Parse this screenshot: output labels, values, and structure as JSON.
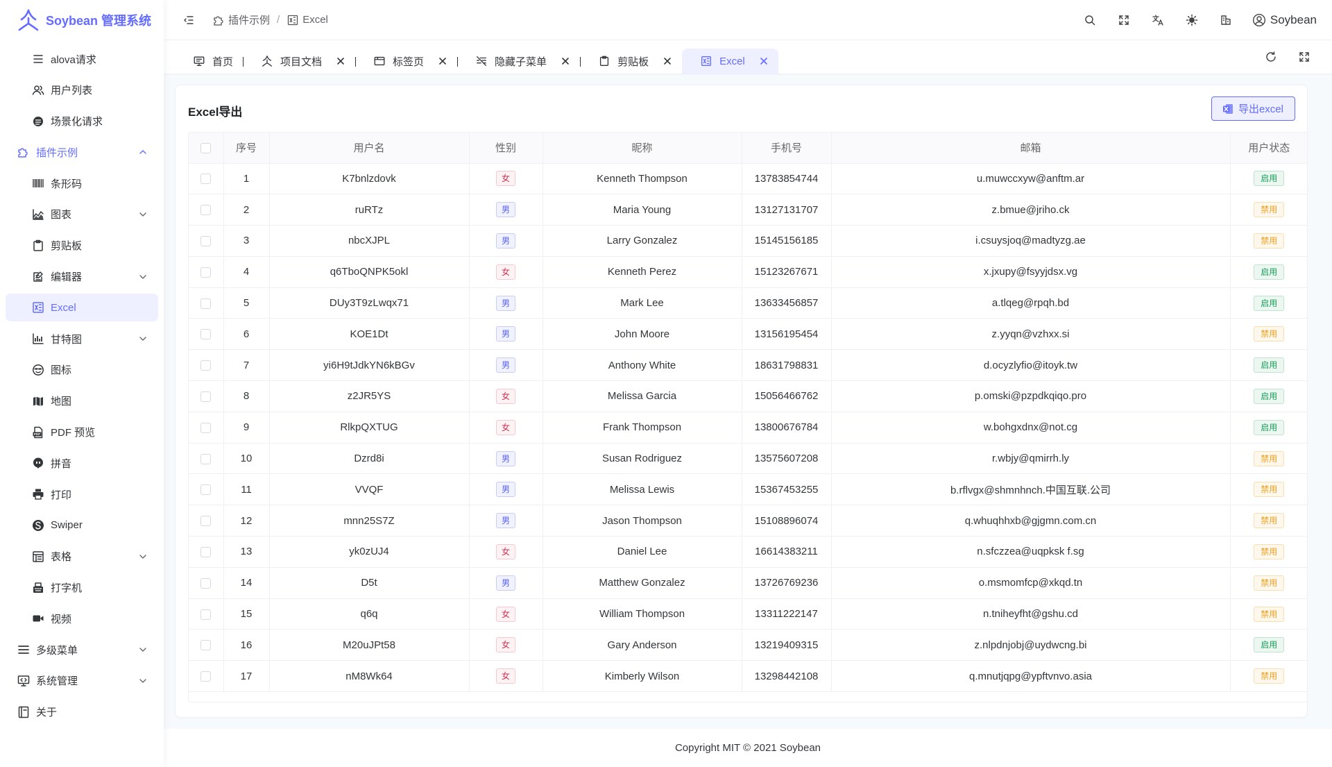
{
  "app": {
    "title": "Soybean 管理系统"
  },
  "sidebar": {
    "items": [
      {
        "label": "alova请求",
        "icon": "list-icon",
        "level": 1
      },
      {
        "label": "用户列表",
        "icon": "users-icon",
        "level": 1
      },
      {
        "label": "场景化请求",
        "icon": "stack-icon",
        "level": 1
      },
      {
        "label": "插件示例",
        "icon": "plugin-icon",
        "level": 0,
        "arrow": "up",
        "open": true
      },
      {
        "label": "条形码",
        "icon": "barcode-icon",
        "level": 1
      },
      {
        "label": "图表",
        "icon": "chart-icon",
        "level": 1,
        "arrow": "down"
      },
      {
        "label": "剪贴板",
        "icon": "clipboard-icon",
        "level": 1
      },
      {
        "label": "编辑器",
        "icon": "editor-icon",
        "level": 1,
        "arrow": "down"
      },
      {
        "label": "Excel",
        "icon": "excel-icon",
        "level": 1,
        "active": true
      },
      {
        "label": "甘特图",
        "icon": "gantt-icon",
        "level": 1,
        "arrow": "down"
      },
      {
        "label": "图标",
        "icon": "emoji-icon",
        "level": 1
      },
      {
        "label": "地图",
        "icon": "map-icon",
        "level": 1
      },
      {
        "label": "PDF 预览",
        "icon": "pdf-icon",
        "level": 1
      },
      {
        "label": "拼音",
        "icon": "pinyin-icon",
        "level": 1
      },
      {
        "label": "打印",
        "icon": "printer-icon",
        "level": 1
      },
      {
        "label": "Swiper",
        "icon": "swiper-icon",
        "level": 1
      },
      {
        "label": "表格",
        "icon": "table-icon",
        "level": 1,
        "arrow": "down"
      },
      {
        "label": "打字机",
        "icon": "typewriter-icon",
        "level": 1
      },
      {
        "label": "视频",
        "icon": "video-icon",
        "level": 1
      },
      {
        "label": "多级菜单",
        "icon": "menu-icon",
        "level": 0,
        "arrow": "down"
      },
      {
        "label": "系统管理",
        "icon": "monitor-icon",
        "level": 0,
        "arrow": "down"
      },
      {
        "label": "关于",
        "icon": "about-icon",
        "level": 0
      }
    ]
  },
  "header": {
    "breadcrumb": [
      {
        "label": "插件示例",
        "icon": "plugin-icon"
      },
      {
        "label": "Excel",
        "icon": "excel-icon"
      }
    ],
    "separator": "/",
    "user": "Soybean"
  },
  "tabs": [
    {
      "label": "首页",
      "icon": "home-icon",
      "closable": false
    },
    {
      "label": "项目文档",
      "icon": "logo-icon",
      "closable": true
    },
    {
      "label": "标签页",
      "icon": "tab-icon",
      "closable": true
    },
    {
      "label": "隐藏子菜单",
      "icon": "hidden-icon",
      "closable": true
    },
    {
      "label": "剪贴板",
      "icon": "clipboard-icon",
      "closable": true
    },
    {
      "label": "Excel",
      "icon": "excel-icon",
      "closable": true,
      "active": true
    }
  ],
  "card": {
    "title": "Excel导出",
    "export_label": "导出excel"
  },
  "table": {
    "columns": [
      "序号",
      "用户名",
      "性别",
      "昵称",
      "手机号",
      "邮箱",
      "用户状态"
    ],
    "rows": [
      {
        "index": "1",
        "username": "K7bnlzdovk",
        "gender": "女",
        "nickname": "Kenneth Thompson",
        "phone": "13783854744",
        "email": "u.muwccxyw@anftm.ar",
        "status": "启用"
      },
      {
        "index": "2",
        "username": "ruRTz",
        "gender": "男",
        "nickname": "Maria Young",
        "phone": "13127131707",
        "email": "z.bmue@jriho.ck",
        "status": "禁用"
      },
      {
        "index": "3",
        "username": "nbcXJPL",
        "gender": "男",
        "nickname": "Larry Gonzalez",
        "phone": "15145156185",
        "email": "i.csuysjoq@madtyzg.ae",
        "status": "禁用"
      },
      {
        "index": "4",
        "username": "q6TboQNPK5okl",
        "gender": "女",
        "nickname": "Kenneth Perez",
        "phone": "15123267671",
        "email": "x.jxupy@fsyyjdsx.vg",
        "status": "启用"
      },
      {
        "index": "5",
        "username": "DUy3T9zLwqx71",
        "gender": "男",
        "nickname": "Mark Lee",
        "phone": "13633456857",
        "email": "a.tlqeg@rpqh.bd",
        "status": "启用"
      },
      {
        "index": "6",
        "username": "KOE1Dt",
        "gender": "男",
        "nickname": "John Moore",
        "phone": "13156195454",
        "email": "z.yyqn@vzhxx.si",
        "status": "禁用"
      },
      {
        "index": "7",
        "username": "yi6H9tJdkYN6kBGv",
        "gender": "男",
        "nickname": "Anthony White",
        "phone": "18631798831",
        "email": "d.ocyzlyfio@itoyk.tw",
        "status": "启用"
      },
      {
        "index": "8",
        "username": "z2JR5YS",
        "gender": "女",
        "nickname": "Melissa Garcia",
        "phone": "15056466762",
        "email": "p.omski@pzpdkqiqo.pro",
        "status": "启用"
      },
      {
        "index": "9",
        "username": "RlkpQXTUG",
        "gender": "女",
        "nickname": "Frank Thompson",
        "phone": "13800676784",
        "email": "w.bohgxdnx@not.cg",
        "status": "启用"
      },
      {
        "index": "10",
        "username": "Dzrd8i",
        "gender": "男",
        "nickname": "Susan Rodriguez",
        "phone": "13575607208",
        "email": "r.wbjy@qmirrh.ly",
        "status": "禁用"
      },
      {
        "index": "11",
        "username": "VVQF",
        "gender": "男",
        "nickname": "Melissa Lewis",
        "phone": "15367453255",
        "email": "b.rflvgx@shmnhnch.中国互联.公司",
        "status": "禁用"
      },
      {
        "index": "12",
        "username": "mnn25S7Z",
        "gender": "男",
        "nickname": "Jason Thompson",
        "phone": "15108896074",
        "email": "q.whuqhhxb@gjgmn.com.cn",
        "status": "禁用"
      },
      {
        "index": "13",
        "username": "yk0zUJ4",
        "gender": "女",
        "nickname": "Daniel Lee",
        "phone": "16614383211",
        "email": "n.sfczzea@uqpksk f.sg",
        "status": "禁用"
      },
      {
        "index": "14",
        "username": "D5t",
        "gender": "男",
        "nickname": "Matthew Gonzalez",
        "phone": "13726769236",
        "email": "o.msmomfcp@xkqd.tn",
        "status": "禁用"
      },
      {
        "index": "15",
        "username": "q6q",
        "gender": "女",
        "nickname": "William Thompson",
        "phone": "13311222147",
        "email": "n.tniheyfht@gshu.cd",
        "status": "禁用"
      },
      {
        "index": "16",
        "username": "M20uJPt58",
        "gender": "女",
        "nickname": "Gary Anderson",
        "phone": "13219409315",
        "email": "z.nlpdnjobj@uydwcng.bi",
        "status": "启用"
      },
      {
        "index": "17",
        "username": "nM8Wk64",
        "gender": "女",
        "nickname": "Kimberly Wilson",
        "phone": "13298442108",
        "email": "q.mnutjqpg@ypftvnvo.asia",
        "status": "禁用"
      }
    ]
  },
  "footer": {
    "text": "Copyright MIT © 2021 Soybean"
  },
  "colors": {
    "primary": "#646cff",
    "success": "#18a058",
    "warning": "#f0a020",
    "error": "#d03050"
  }
}
